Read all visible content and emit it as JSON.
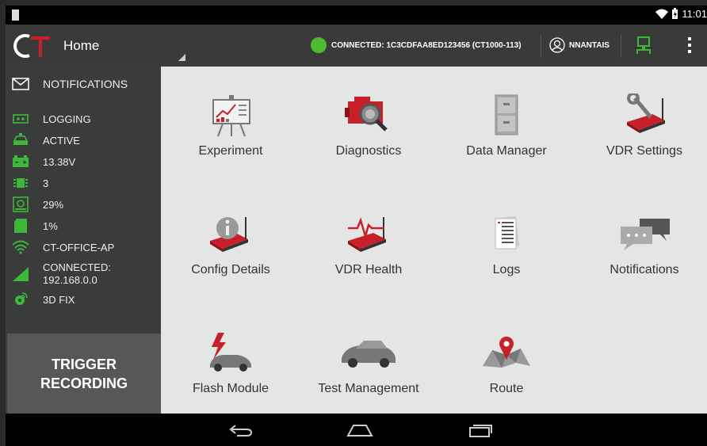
{
  "status_bar": {
    "time": "11:01"
  },
  "app_bar": {
    "logo_text": "CT",
    "title": "Home",
    "connection": "CONNECTED: 1C3CDFAA8ED123456 (CT1000-113)",
    "user": "NNANTAIS"
  },
  "sidebar": {
    "notifications": "NOTIFICATIONS",
    "items": [
      {
        "icon": "tape-icon",
        "label": "LOGGING"
      },
      {
        "icon": "vehicle-icon",
        "label": "ACTIVE"
      },
      {
        "icon": "battery-icon",
        "label": "13.38V"
      },
      {
        "icon": "chip-icon",
        "label": "3"
      },
      {
        "icon": "storage-icon",
        "label": "29%"
      },
      {
        "icon": "sd-card-icon",
        "label": "1%"
      },
      {
        "icon": "wifi-icon",
        "label": "CT-OFFICE-AP"
      },
      {
        "icon": "signal-icon",
        "label": "CONNECTED:",
        "label2": "192.168.0.0"
      },
      {
        "icon": "satellite-icon",
        "label": "3D FIX"
      }
    ],
    "trigger": {
      "line1": "TRIGGER",
      "line2": "RECORDING"
    }
  },
  "tiles": [
    {
      "label": "Experiment",
      "icon": "experiment-icon"
    },
    {
      "label": "Diagnostics",
      "icon": "diagnostics-icon"
    },
    {
      "label": "Data Manager",
      "icon": "data-manager-icon"
    },
    {
      "label": "VDR Settings",
      "icon": "vdr-settings-icon"
    },
    {
      "label": "Config Details",
      "icon": "config-details-icon"
    },
    {
      "label": "VDR Health",
      "icon": "vdr-health-icon"
    },
    {
      "label": "Logs",
      "icon": "logs-icon"
    },
    {
      "label": "Notifications",
      "icon": "notifications-icon"
    },
    {
      "label": "Flash Module",
      "icon": "flash-module-icon"
    },
    {
      "label": "Test Management",
      "icon": "test-management-icon"
    },
    {
      "label": "Route",
      "icon": "route-icon"
    }
  ],
  "colors": {
    "accent_red": "#c8202a",
    "connected_green": "#4cbb2f",
    "sidebar_green": "#3db83a"
  }
}
